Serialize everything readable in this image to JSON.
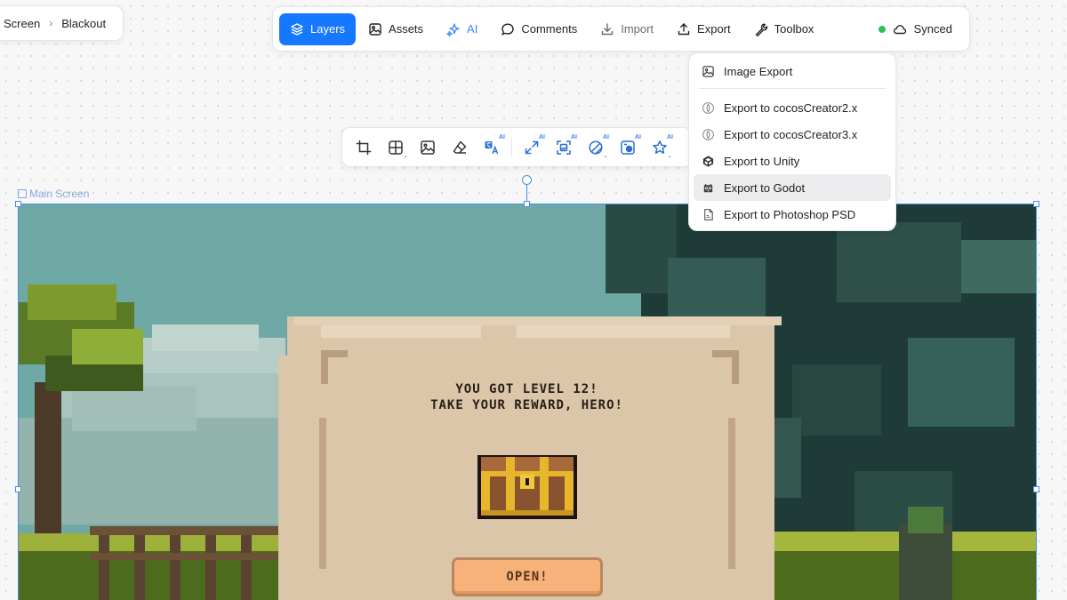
{
  "breadcrumb": {
    "items": [
      "Screen",
      "Blackout"
    ],
    "separator": "›"
  },
  "toolbar": {
    "buttons": [
      {
        "label": "Layers",
        "icon": "layers-icon",
        "state": "active"
      },
      {
        "label": "Assets",
        "icon": "image-icon"
      },
      {
        "label": "AI",
        "icon": "sparkles-icon"
      },
      {
        "label": "Comments",
        "icon": "comment-icon"
      },
      {
        "label": "Import",
        "icon": "download-icon"
      },
      {
        "label": "Export",
        "icon": "upload-icon"
      },
      {
        "label": "Toolbox",
        "icon": "wrench-icon"
      }
    ],
    "sync_label": "Synced",
    "active_color": "#1677ff",
    "sync_color": "#2ec05a"
  },
  "export_menu": {
    "items": [
      {
        "label": "Image Export",
        "icon": "image-icon"
      },
      {
        "label": "Export to cocosCreator2.x",
        "icon": "cocos-icon"
      },
      {
        "label": "Export to cocosCreator3.x",
        "icon": "cocos-icon"
      },
      {
        "label": "Export to Unity",
        "icon": "unity-icon"
      },
      {
        "label": "Export to Godot",
        "icon": "godot-icon",
        "state": "hover"
      },
      {
        "label": "Export to Photoshop PSD",
        "icon": "psd-file-icon"
      }
    ]
  },
  "image_tools": {
    "ai_badge": "AI",
    "tools": [
      {
        "name": "crop-icon"
      },
      {
        "name": "grid-icon",
        "has_menu": true
      },
      {
        "name": "image-replace-icon"
      },
      {
        "name": "eraser-icon"
      },
      {
        "name": "translate-icon",
        "ai": true
      },
      {
        "name": "expand-icon",
        "ai": true
      },
      {
        "name": "upscale-icon",
        "ai": true
      },
      {
        "name": "remove-background-icon",
        "ai": true,
        "has_menu": true
      },
      {
        "name": "inpaint-icon",
        "ai": true
      },
      {
        "name": "star-icon",
        "ai": true,
        "has_menu": true
      }
    ]
  },
  "canvas": {
    "frame_label": "Main Screen",
    "selection_color": "#4a90e2"
  },
  "game_ui": {
    "title_line1": "YOU GOT LEVEL 12!",
    "title_line2": "TAKE YOUR REWARD, HERO!",
    "button_label": "OPEN!"
  }
}
